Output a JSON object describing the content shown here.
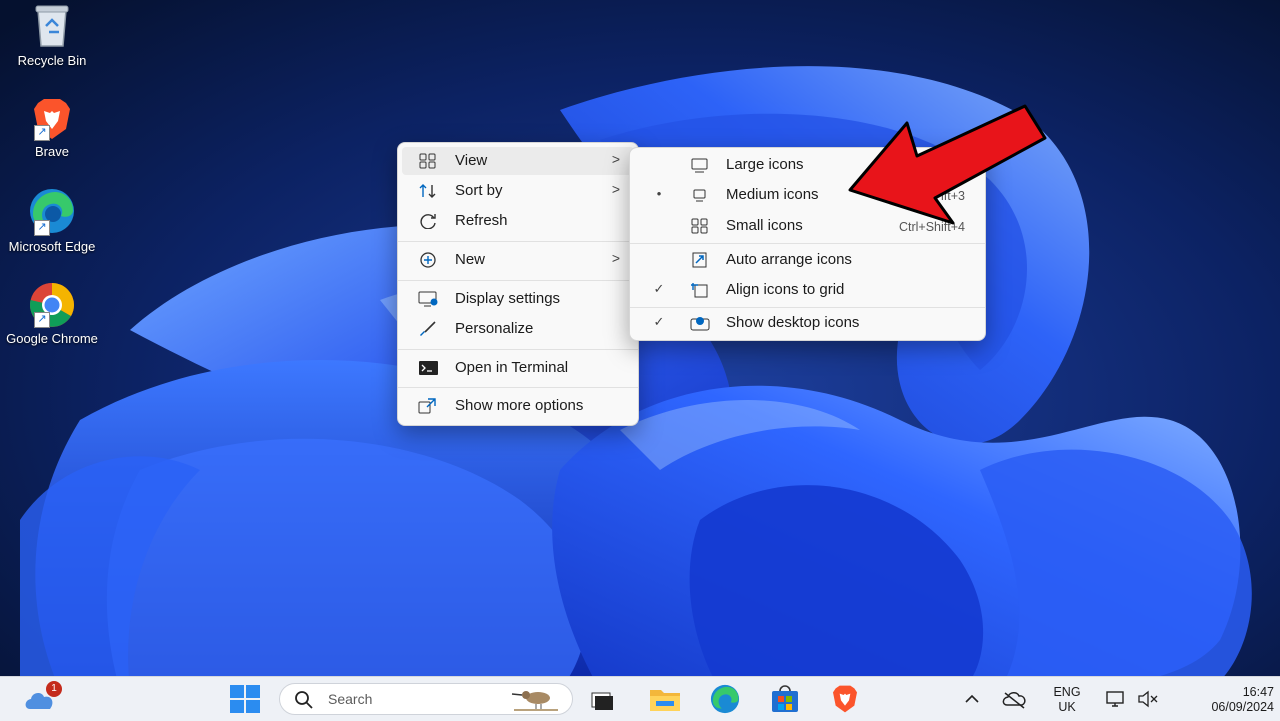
{
  "desktop": {
    "icons": [
      {
        "label": "Recycle Bin"
      },
      {
        "label": "Brave"
      },
      {
        "label": "Microsoft Edge"
      },
      {
        "label": "Google Chrome"
      }
    ]
  },
  "context_menu": {
    "items": [
      {
        "label": "View",
        "icon": "grid-icon",
        "submenu": true
      },
      {
        "label": "Sort by",
        "icon": "sort-icon",
        "submenu": true
      },
      {
        "label": "Refresh",
        "icon": "refresh-icon"
      },
      {
        "label": "New",
        "icon": "plus-circle-icon",
        "submenu": true
      },
      {
        "label": "Display settings",
        "icon": "display-icon"
      },
      {
        "label": "Personalize",
        "icon": "brush-icon"
      },
      {
        "label": "Open in Terminal",
        "icon": "terminal-icon"
      },
      {
        "label": "Show more options",
        "icon": "expand-icon"
      }
    ]
  },
  "view_submenu": {
    "items": [
      {
        "label": "Large icons",
        "shortcut": "",
        "mark": "",
        "icon": "monitor-icon"
      },
      {
        "label": "Medium icons",
        "shortcut": "ift+3",
        "mark": "•",
        "icon": "monitor-small-icon"
      },
      {
        "label": "Small icons",
        "shortcut": "Ctrl+Shift+4",
        "mark": "",
        "icon": "grid-icon"
      },
      {
        "label": "Auto arrange icons",
        "shortcut": "",
        "mark": "",
        "icon": "auto-arrange-icon"
      },
      {
        "label": "Align icons to grid",
        "shortcut": "",
        "mark": "✓",
        "icon": "align-grid-icon"
      },
      {
        "label": "Show desktop icons",
        "shortcut": "",
        "mark": "✓",
        "icon": "show-desktop-icon"
      }
    ]
  },
  "taskbar": {
    "search_placeholder": "Search",
    "weather_badge": "1",
    "language": "ENG",
    "region": "UK",
    "time": "16:47",
    "date": "06/09/2024"
  },
  "colors": {
    "accent": "#0067c0",
    "arrow": "#e8141a",
    "menu_bg": "#f9f9f9",
    "taskbar_bg": "#eef1f6"
  }
}
